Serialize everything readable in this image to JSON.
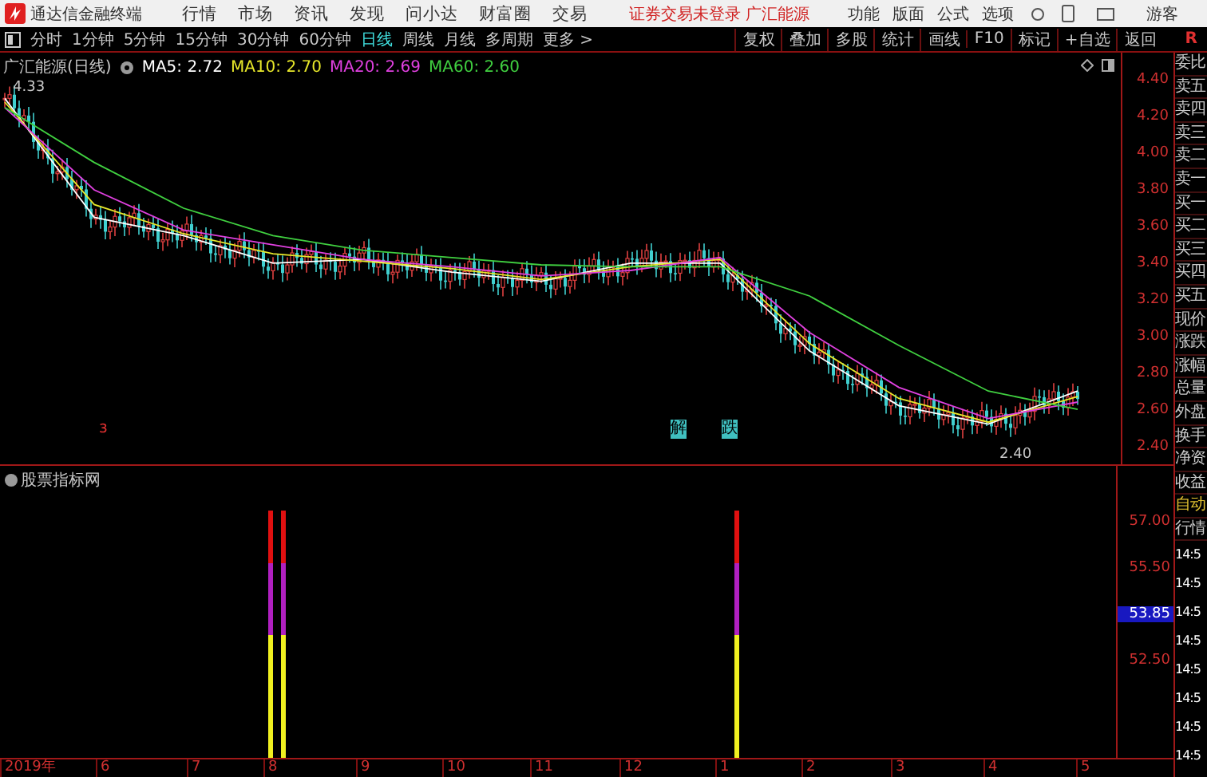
{
  "app": {
    "title": "通达信金融终端",
    "menus": [
      "行情",
      "市场",
      "资讯",
      "发现",
      "问小达",
      "财富圈",
      "交易"
    ],
    "status": "证券交易未登录 广汇能源",
    "right_menus": [
      "功能",
      "版面",
      "公式",
      "选项"
    ],
    "user": "游客"
  },
  "periods": [
    {
      "label": "分时",
      "selected": false
    },
    {
      "label": "1分钟",
      "selected": false
    },
    {
      "label": "5分钟",
      "selected": false
    },
    {
      "label": "15分钟",
      "selected": false
    },
    {
      "label": "30分钟",
      "selected": false
    },
    {
      "label": "60分钟",
      "selected": false
    },
    {
      "label": "日线",
      "selected": true
    },
    {
      "label": "周线",
      "selected": false
    },
    {
      "label": "月线",
      "selected": false
    },
    {
      "label": "多周期",
      "selected": false
    },
    {
      "label": "更多 >",
      "selected": false
    }
  ],
  "tools": [
    "复权",
    "叠加",
    "多股",
    "统计",
    "画线",
    "F10",
    "标记",
    "+自选",
    "返回"
  ],
  "tools_mark": "R",
  "chart": {
    "title": "广汇能源(日线)",
    "ma": [
      {
        "label": "MA5: 2.72",
        "color": "#ffffff"
      },
      {
        "label": "MA10: 2.70",
        "color": "#e8e82a"
      },
      {
        "label": "MA20: 2.69",
        "color": "#e040e0"
      },
      {
        "label": "MA60: 2.60",
        "color": "#40d040"
      }
    ],
    "high_label": "4.33",
    "low_label": "2.40",
    "chart_data": {
      "type": "line",
      "ylim": [
        2.3,
        4.55
      ],
      "yticks": [
        {
          "value": 4.4,
          "label": "4.40"
        },
        {
          "value": 4.2,
          "label": "4.20"
        },
        {
          "value": 4.0,
          "label": "4.00"
        },
        {
          "value": 3.8,
          "label": "3.80"
        },
        {
          "value": 3.6,
          "label": "3.60"
        },
        {
          "value": 3.4,
          "label": "3.40"
        },
        {
          "value": 3.2,
          "label": "3.20"
        },
        {
          "value": 3.0,
          "label": "3.00"
        },
        {
          "value": 2.8,
          "label": "2.80"
        },
        {
          "value": 2.6,
          "label": "2.60"
        },
        {
          "value": 2.4,
          "label": "2.40"
        }
      ],
      "series": [
        {
          "color": "#ffffff",
          "values": [
            4.3,
            3.65,
            3.55,
            3.4,
            3.42,
            3.35,
            3.3,
            3.4,
            3.4,
            2.92,
            2.62,
            2.52,
            2.7
          ]
        },
        {
          "color": "#e8e82a",
          "values": [
            4.28,
            3.72,
            3.56,
            3.45,
            3.41,
            3.37,
            3.31,
            3.38,
            3.42,
            2.96,
            2.66,
            2.53,
            2.67
          ]
        },
        {
          "color": "#e040e0",
          "values": [
            4.25,
            3.8,
            3.58,
            3.5,
            3.42,
            3.38,
            3.33,
            3.36,
            3.43,
            3.02,
            2.72,
            2.55,
            2.64
          ]
        },
        {
          "color": "#40d040",
          "values": [
            4.25,
            3.95,
            3.7,
            3.55,
            3.47,
            3.43,
            3.39,
            3.38,
            3.38,
            3.22,
            2.95,
            2.7,
            2.6
          ]
        }
      ]
    },
    "markers": [
      {
        "label": "з",
        "kind": "plain"
      },
      {
        "label": "解",
        "kind": "box"
      },
      {
        "label": "跌",
        "kind": "box"
      }
    ]
  },
  "dates": [
    "2019年",
    "6",
    "7",
    "8",
    "9",
    "10",
    "11",
    "12",
    "1",
    "2",
    "3",
    "4",
    "5"
  ],
  "indicator": {
    "title": "股票指标网",
    "ticks": [
      {
        "label": "57.00",
        "highlighted": false
      },
      {
        "label": "55.50",
        "highlighted": false
      },
      {
        "label": "53.85",
        "highlighted": true
      },
      {
        "label": "52.50",
        "highlighted": false
      }
    ]
  },
  "quote_panel": {
    "labels": [
      "委比",
      "卖五",
      "卖四",
      "卖三",
      "卖二",
      "卖一",
      "买一",
      "买二",
      "买三",
      "买四",
      "买五",
      "现价",
      "涨跌",
      "涨幅",
      "总量",
      "外盘",
      "换手",
      "净资",
      "收益"
    ],
    "mode": "自动",
    "section": "行情",
    "times": [
      "14:5",
      "14:5",
      "14:5",
      "14:5",
      "14:5",
      "14:5",
      "14:5",
      "14:5"
    ]
  }
}
